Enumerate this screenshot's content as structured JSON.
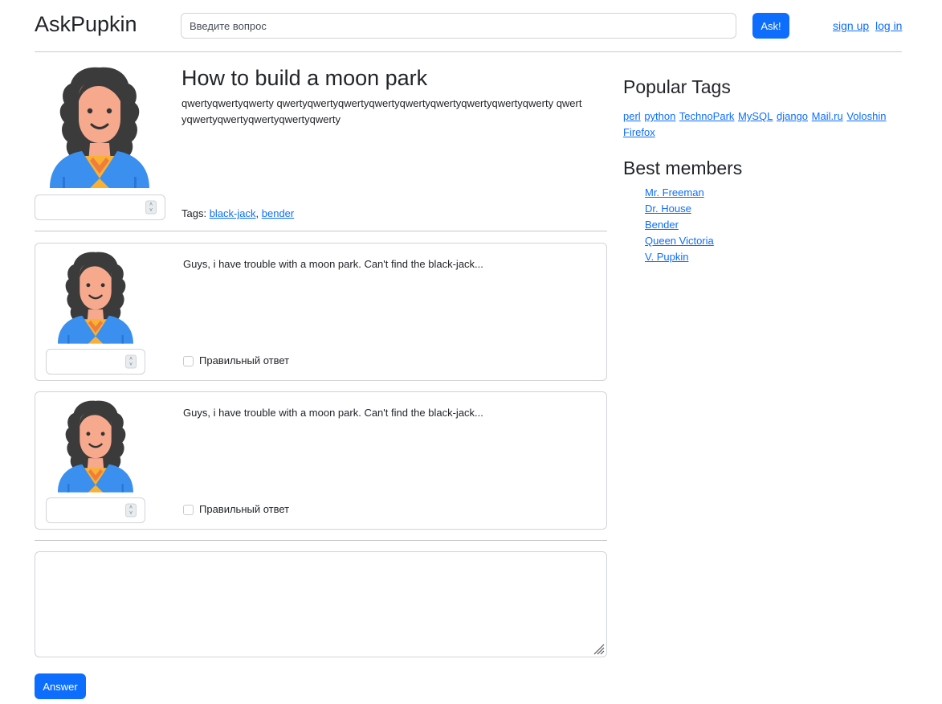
{
  "header": {
    "logo": "AskPupkin",
    "search_placeholder": "Введите вопрос",
    "ask_label": "Ask!",
    "signup_label": "sign up",
    "login_label": "log in"
  },
  "question": {
    "title": "How to build a moon park",
    "text": "qwertyqwertyqwerty qwertyqwertyqwertyqwertyqwertyqwertyqwertyqwertyqwerty qwertyqwertyqwertyqwertyqwertyqwerty",
    "tags_label": "Tags:",
    "tags": [
      "black-jack",
      "bender"
    ],
    "tag_separator": ","
  },
  "answers": [
    {
      "text": "Guys, i have trouble with a moon park. Can't find the black-jack...",
      "correct_label": "Правильный ответ",
      "correct_checked": false
    },
    {
      "text": "Guys, i have trouble with a moon park. Can't find the black-jack...",
      "correct_label": "Правильный ответ",
      "correct_checked": false
    }
  ],
  "answer_form": {
    "submit_label": "Answer"
  },
  "sidebar": {
    "popular_tags_title": "Popular Tags",
    "popular_tags": [
      "perl",
      "python",
      "TechnoPark",
      "MySQL",
      "django",
      "Mail.ru",
      "Voloshin",
      "Firefox"
    ],
    "best_members_title": "Best members",
    "best_members": [
      "Mr. Freeman",
      "Dr. House",
      "Bender",
      "Queen Victoria",
      "V. Pupkin"
    ]
  },
  "colors": {
    "primary": "#0d6efd",
    "avatar_hair": "#3b3b3b",
    "avatar_skin": "#f7a98e",
    "avatar_jacket": "#3b8fef",
    "avatar_shirt": "#f8b135"
  }
}
